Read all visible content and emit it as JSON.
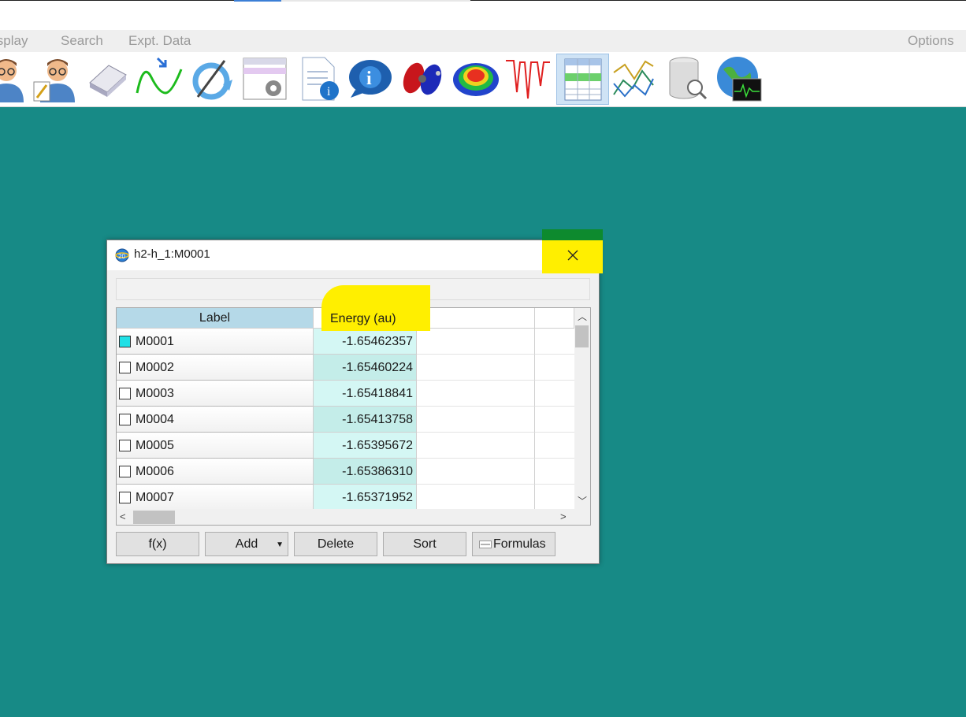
{
  "menu": {
    "display": "isplay",
    "search": "Search",
    "expt_data": "Expt. Data",
    "options": "Options"
  },
  "toolbar": {
    "tools": [
      "person-icon",
      "person-edit-icon",
      "eraser-icon",
      "wave-icon",
      "refresh-icon",
      "window-settings-icon",
      "document-info-icon",
      "info-bubble-icon",
      "orbital-icon",
      "surface-icon",
      "spectrum-icon",
      "table-icon",
      "plot-icon",
      "database-search-icon",
      "globe-monitor-icon"
    ],
    "active": "table-icon"
  },
  "dialog": {
    "title": "h2-h_1:M0001",
    "columns": {
      "label": "Label",
      "energy": "Energy (au)"
    },
    "rows": [
      {
        "label": "M0001",
        "energy": "-1.65462357",
        "checked": true
      },
      {
        "label": "M0002",
        "energy": "-1.65460224",
        "checked": false
      },
      {
        "label": "M0003",
        "energy": "-1.65418841",
        "checked": false
      },
      {
        "label": "M0004",
        "energy": "-1.65413758",
        "checked": false
      },
      {
        "label": "M0005",
        "energy": "-1.65395672",
        "checked": false
      },
      {
        "label": "M0006",
        "energy": "-1.65386310",
        "checked": false
      },
      {
        "label": "M0007",
        "energy": "-1.65371952",
        "checked": false
      }
    ],
    "buttons": {
      "fx": "f(x)",
      "add": "Add",
      "delete": "Delete",
      "sort": "Sort",
      "formulas": "Formulas"
    }
  },
  "colors": {
    "desktop": "#178a86",
    "highlight": "#ffef00",
    "checked": "#1fe0e6",
    "energy_column": "#d4f7f4"
  }
}
